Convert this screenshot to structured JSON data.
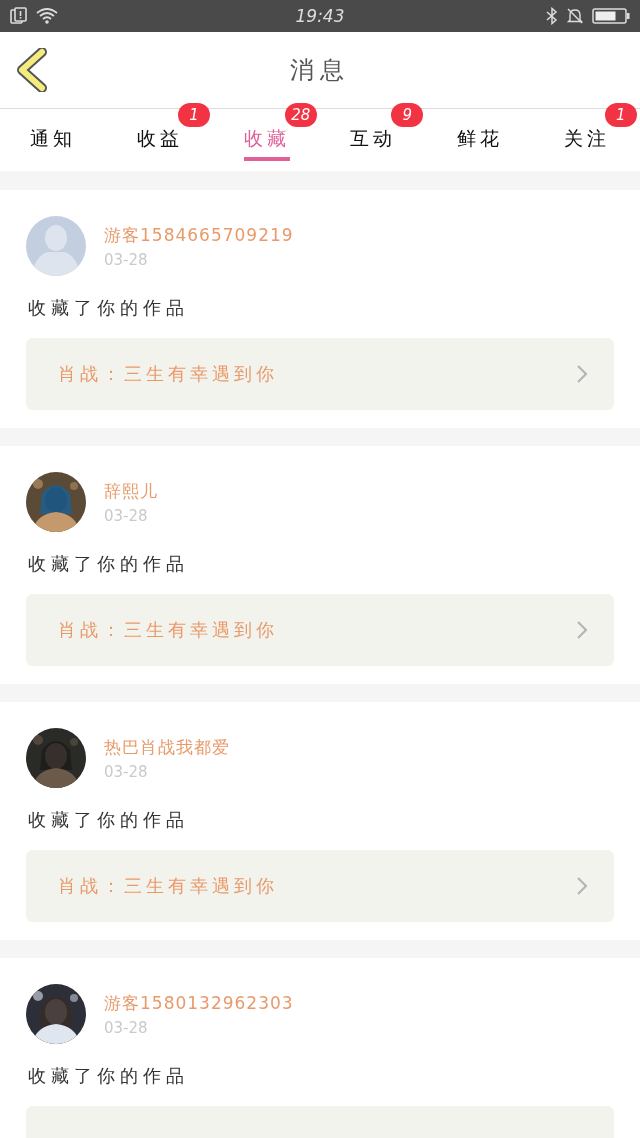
{
  "status_bar": {
    "time": "19:43"
  },
  "header": {
    "title": "消息"
  },
  "tabs": [
    {
      "label": "通知",
      "selected": false
    },
    {
      "label": "收益",
      "selected": false,
      "badge": "1"
    },
    {
      "label": "收藏",
      "selected": true,
      "badge": "28"
    },
    {
      "label": "互动",
      "selected": false,
      "badge": "9"
    },
    {
      "label": "鲜花",
      "selected": false
    },
    {
      "label": "关注",
      "selected": false,
      "badge": "1"
    }
  ],
  "messages": [
    {
      "avatar": {
        "kind": "default"
      },
      "name": "游客1584665709219",
      "date": "03-28",
      "text": "收藏了你的作品",
      "work": "肖战：三生有幸遇到你"
    },
    {
      "name": "辞熙儿",
      "date": "03-28",
      "text": "收藏了你的作品",
      "work": "肖战：三生有幸遇到你"
    },
    {
      "name": "热巴肖战我都爱",
      "date": "03-28",
      "text": "收藏了你的作品",
      "work": "肖战：三生有幸遇到你"
    },
    {
      "name": "游客1580132962303",
      "date": "03-28",
      "text": "收藏了你的作品"
    }
  ]
}
